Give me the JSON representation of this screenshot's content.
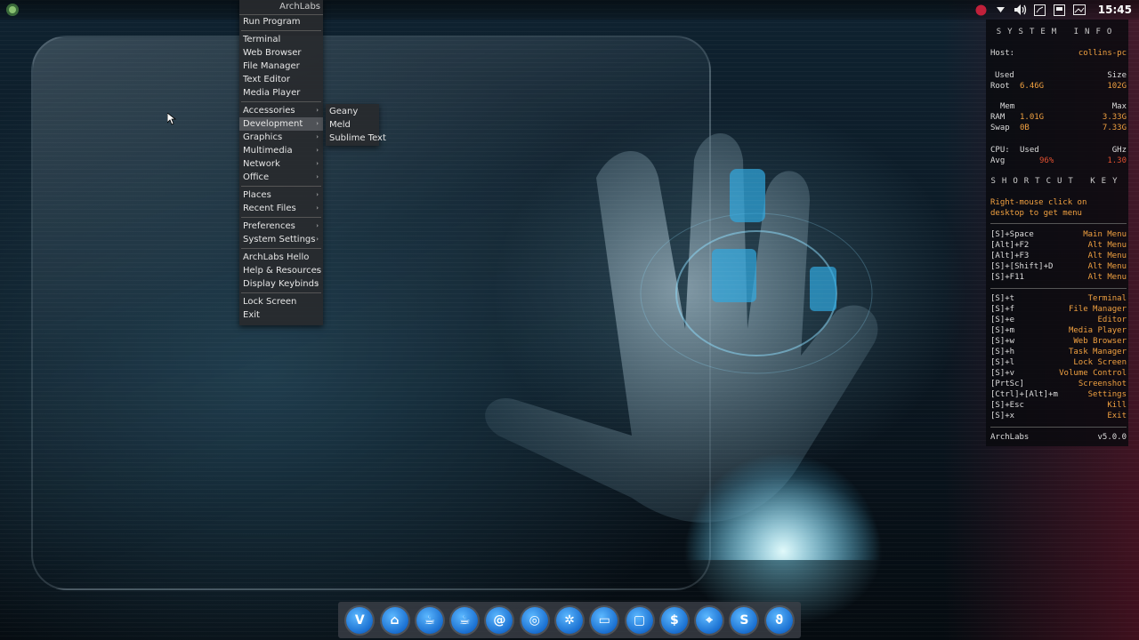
{
  "topbar": {
    "clock": "15:45",
    "tray_icons": [
      "app-indicator-icon",
      "dropdown-arrow-icon",
      "volume-icon",
      "network-icon",
      "battery-icon",
      "screen-icon"
    ]
  },
  "main_menu": {
    "title": "ArchLabs",
    "items": [
      {
        "label": "Run Program"
      },
      {
        "label": "Terminal"
      },
      {
        "label": "Web Browser"
      },
      {
        "label": "File Manager"
      },
      {
        "label": "Text Editor"
      },
      {
        "label": "Media Player"
      },
      {
        "label": "Accessories"
      },
      {
        "label": "Development"
      },
      {
        "label": "Graphics"
      },
      {
        "label": "Multimedia"
      },
      {
        "label": "Network"
      },
      {
        "label": "Office"
      },
      {
        "label": "Places"
      },
      {
        "label": "Recent Files"
      },
      {
        "label": "Preferences"
      },
      {
        "label": "System Settings"
      },
      {
        "label": "ArchLabs Hello"
      },
      {
        "label": "Help & Resources"
      },
      {
        "label": "Display Keybinds"
      },
      {
        "label": "Lock Screen"
      },
      {
        "label": "Exit"
      }
    ],
    "submenu_arrow": "›"
  },
  "development_submenu": {
    "items": [
      {
        "label": "Geany"
      },
      {
        "label": "Meld"
      },
      {
        "label": "Sublime Text"
      }
    ]
  },
  "conky": {
    "system_info_header": "SYSTEM INFO",
    "host_label": "Host:",
    "host_value": "collins-pc",
    "used_label": "Used",
    "size_label": "Size",
    "root_label": "Root",
    "root_used": "6.46G",
    "root_size": "102G",
    "mem_label": "Mem",
    "max_label": "Max",
    "ram_label": "RAM",
    "ram_used": "1.01G",
    "ram_max": "3.33G",
    "swap_label": "Swap",
    "swap_used": "0B",
    "swap_max": "7.33G",
    "cpu_label": "CPU:",
    "cpu_used_label": "Used",
    "ghz_label": "GHz",
    "avg_label": "Avg",
    "cpu_used": "96%",
    "cpu_ghz": "1.30",
    "shortcut_header": "SHORTCUT KEY",
    "hint_line1": "Right-mouse click on",
    "hint_line2": "desktop to get menu",
    "shortcuts_group1": [
      {
        "key": "[S]+Space",
        "action": "Main Menu"
      },
      {
        "key": "[Alt]+F2",
        "action": "Alt Menu"
      },
      {
        "key": "[Alt]+F3",
        "action": "Alt Menu"
      },
      {
        "key": "[S]+[Shift]+D",
        "action": "Alt Menu"
      },
      {
        "key": "[S]+F11",
        "action": "Alt Menu"
      }
    ],
    "shortcuts_group2": [
      {
        "key": "[S]+t",
        "action": "Terminal"
      },
      {
        "key": "[S]+f",
        "action": "File Manager"
      },
      {
        "key": "[S]+e",
        "action": "Editor"
      },
      {
        "key": "[S]+m",
        "action": "Media Player"
      },
      {
        "key": "[S]+w",
        "action": "Web Browser"
      },
      {
        "key": "[S]+h",
        "action": "Task Manager"
      },
      {
        "key": "[S]+l",
        "action": "Lock Screen"
      },
      {
        "key": "[S]+v",
        "action": "Volume Control"
      },
      {
        "key": "[PrtSc]",
        "action": "Screenshot"
      },
      {
        "key": "[Ctrl]+[Alt]+m",
        "action": "Settings"
      },
      {
        "key": "[S]+Esc",
        "action": "Kill"
      },
      {
        "key": "[S]+x",
        "action": "Exit"
      }
    ],
    "footer_name": "ArchLabs",
    "footer_version": "v5.0.0"
  },
  "dock": {
    "apps": [
      {
        "icon": "vivaldi-icon",
        "glyph": "V"
      },
      {
        "icon": "home-icon",
        "glyph": "⌂"
      },
      {
        "icon": "teapot-icon",
        "glyph": "☕"
      },
      {
        "icon": "teapot-icon-2",
        "glyph": "☕"
      },
      {
        "icon": "swirl-icon",
        "glyph": "@"
      },
      {
        "icon": "chrome-icon",
        "glyph": "◎"
      },
      {
        "icon": "aperture-icon",
        "glyph": "✲"
      },
      {
        "icon": "files-icon",
        "glyph": "▭"
      },
      {
        "icon": "window-icon",
        "glyph": "▢"
      },
      {
        "icon": "money-icon",
        "glyph": "$"
      },
      {
        "icon": "screenshot-icon",
        "glyph": "⌖"
      },
      {
        "icon": "skype-icon",
        "glyph": "S"
      },
      {
        "icon": "firefox-icon",
        "glyph": "ϑ"
      }
    ]
  },
  "colors": {
    "accent_orange": "#f0a040",
    "cpu_red": "#e05030",
    "menu_bg": "#2a2c2e",
    "dock_blue": "#1a6fd0"
  }
}
